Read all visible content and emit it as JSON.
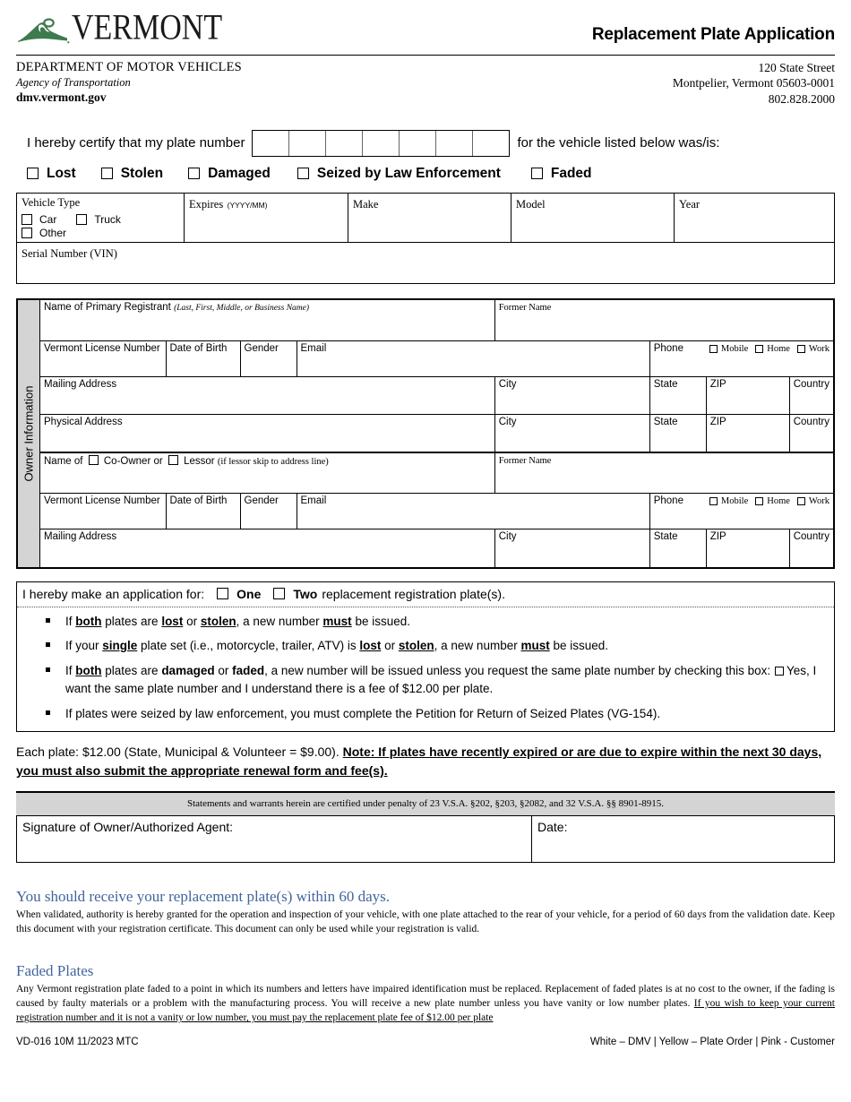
{
  "header": {
    "logo_word": "VERMONT",
    "logo_icon": "vermont-mountain-logo",
    "doc_title": "Replacement Plate Application",
    "agency_line1": "DEPARTMENT OF MOTOR VEHICLES",
    "agency_line2": "Agency of Transportation",
    "agency_line3": "dmv.vermont.gov",
    "address_line1": "120 State Street",
    "address_line2": "Montpelier, Vermont 05603-0001",
    "address_line3": "802.828.2000"
  },
  "certify": {
    "lead_text": "I hereby certify that my plate number",
    "trail_text": "for the vehicle listed below was/is:",
    "plate_cells": 7,
    "status_options": [
      "Lost",
      "Stolen",
      "Damaged",
      "Seized by Law Enforcement",
      "Faded"
    ]
  },
  "vehicle": {
    "type_label": "Vehicle Type",
    "type_options": [
      "Car",
      "Truck",
      "Other"
    ],
    "expires_label": "Expires",
    "expires_hint": "(YYYY/MM)",
    "make_label": "Make",
    "model_label": "Model",
    "year_label": "Year",
    "vin_label": "Serial Number (VIN)"
  },
  "owner": {
    "side_label": "Owner Information",
    "primary_name_label": "Name of Primary Registrant",
    "primary_name_hint": "(Last, First, Middle, or Business Name)",
    "former_name_label": "Former Name",
    "license_label": "Vermont License Number",
    "dob_label": "Date of Birth",
    "gender_label": "Gender",
    "email_label": "Email",
    "phone_label": "Phone",
    "phone_options": [
      "Mobile",
      "Home",
      "Work"
    ],
    "mailing_label": "Mailing Address",
    "physical_label": "Physical Address",
    "city_label": "City",
    "state_label": "State",
    "zip_label": "ZIP",
    "country_label": "Country",
    "coowner_prefix": "Name of",
    "coowner_option1": "Co-Owner",
    "coowner_or": "or",
    "coowner_option2": "Lessor",
    "coowner_hint": "(if lessor skip to address line)"
  },
  "application": {
    "lead": "I hereby make an application for:",
    "option_one": "One",
    "option_two": "Two",
    "trail": "replacement registration plate(s).",
    "bullets": [
      {
        "id": "bullet-both-lost-stolen"
      },
      {
        "id": "bullet-single-plate-set"
      },
      {
        "id": "bullet-both-damaged-faded"
      },
      {
        "id": "bullet-seized-by-law"
      }
    ],
    "bullet1_parts": {
      "a": "If ",
      "b": "both",
      "c": " plates are ",
      "d": "lost",
      "e": " or ",
      "f": "stolen",
      "g": ", a new number ",
      "h": "must",
      "i": " be issued."
    },
    "bullet2_parts": {
      "a": "If your ",
      "b": "single",
      "c": " plate set (i.e., motorcycle, trailer, ATV) is ",
      "d": "lost",
      "e": " or ",
      "f": "stolen",
      "g": ", a new number ",
      "h": "must",
      "i": " be issued."
    },
    "bullet3_parts": {
      "a": "If ",
      "b": "both",
      "c": " plates are ",
      "d": "damaged",
      "e": " or ",
      "f": "faded",
      "g": ", a new number will be issued unless you request the same plate number by checking this box: ",
      "h": "Yes, I want the same plate number and I understand there is a fee of $12.00 per plate."
    },
    "bullet4_text": "If plates were seized by law enforcement, you must complete the Petition for Return of Seized Plates (VG-154)."
  },
  "fee": {
    "plain": "Each plate: $12.00 (State, Municipal & Volunteer = $9.00). ",
    "note_label": "Note:",
    "note_text": " If plates have recently expired or are due to expire within the next 30 days, you must also submit the appropriate renewal form and fee(s)."
  },
  "statements": {
    "text": "Statements and warrants herein are certified under penalty of 23 V.S.A. §202, §203, §2082, and 32 V.S.A. §§ 8901-8915.",
    "signature_label": "Signature of Owner/Authorized Agent:",
    "date_label": "Date:"
  },
  "notices": [
    {
      "heading": "You should receive your replacement plate(s) within 60 days.",
      "body": "When validated, authority is hereby granted for the operation and inspection of your vehicle, with one plate attached to the rear of your vehicle, for a period of 60 days from the validation date. Keep this document with your registration certificate. This document can only be used while your registration is valid."
    }
  ],
  "faded": {
    "heading": "Faded Plates",
    "body_plain": "Any Vermont registration plate faded to a point in which its numbers and letters have impaired identification must be replaced. Replacement of faded plates is at no cost to the owner, if the fading is caused by faulty materials or a problem with the manufacturing process. You will receive a new plate number unless you have vanity or low number plates. ",
    "body_underlined": "If you wish to keep your current registration number and it is not a vanity or low number, you must pay the replacement plate fee of $12.00 per plate"
  },
  "footer": {
    "left": "VD-016 10M 11/2023 MTC",
    "right": "White – DMV | Yellow – Plate Order | Pink - Customer"
  },
  "colors": {
    "logo_green": "#3d7a4e",
    "heading_blue": "#41659e",
    "shade_gray": "#d4d4d4"
  }
}
